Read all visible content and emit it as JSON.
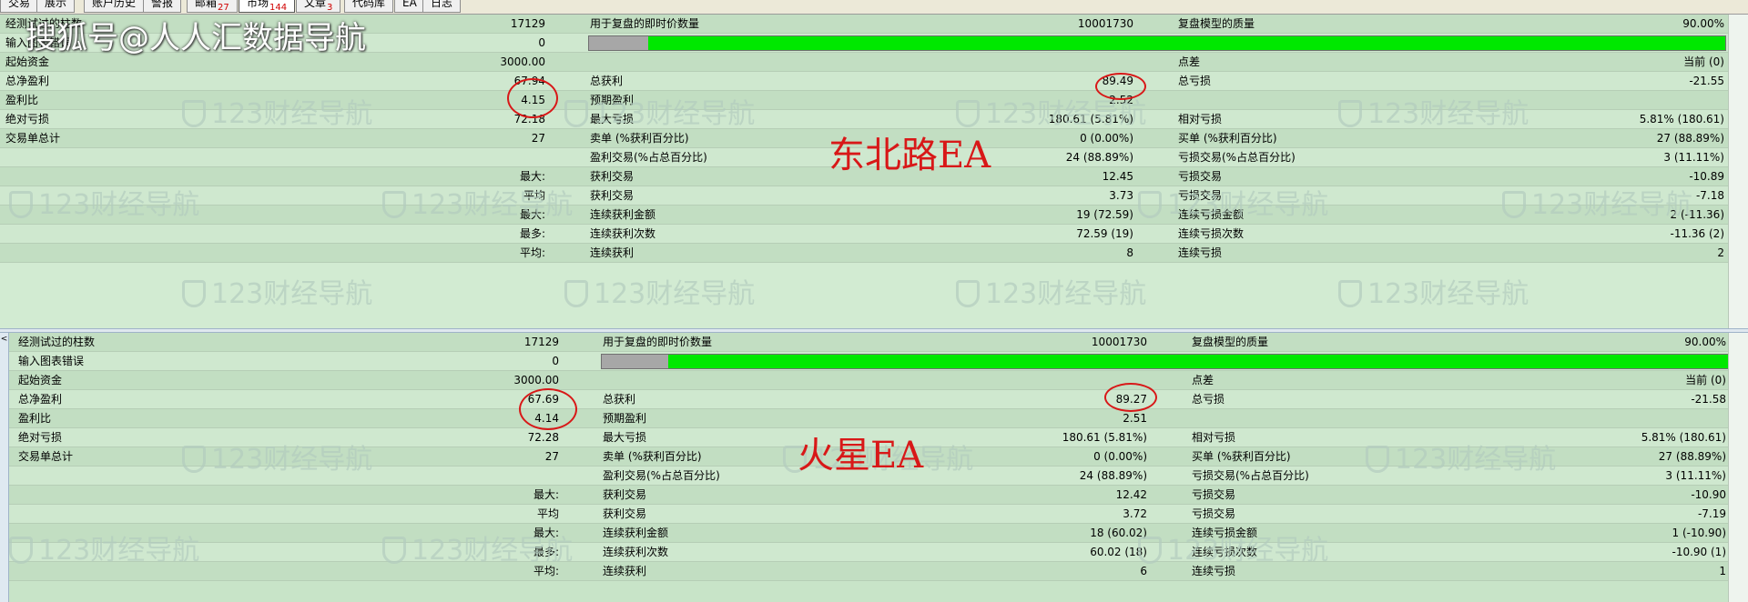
{
  "tabs": [
    {
      "label": "交易",
      "badge": ""
    },
    {
      "label": "展示",
      "badge": ""
    },
    {
      "label": "账户历史",
      "badge": ""
    },
    {
      "label": "警报",
      "badge": ""
    },
    {
      "label": "邮箱",
      "badge": "27"
    },
    {
      "label": "市场",
      "badge": "144"
    },
    {
      "label": "文章",
      "badge": "3"
    },
    {
      "label": "代码库",
      "badge": ""
    },
    {
      "label": "EA",
      "badge": ""
    },
    {
      "label": "日志",
      "badge": ""
    }
  ],
  "active_tab": 5,
  "source_watermark": "搜狐号@人人汇数据导航",
  "bg_watermark": "123财经导航",
  "colors": {
    "annotation_red": "#d81818",
    "progress_green": "#00e800",
    "progress_gray": "#a7a7a7"
  },
  "top_report": {
    "annotation_label": "东北路EA",
    "progress_fraction": 0.052,
    "rows": [
      {
        "c1l": "经测试过的柱数",
        "c1v": "17129",
        "c2l": "用于复盘的即时价数量",
        "c2v": "10001730",
        "c3l": "复盘模型的质量",
        "c3v": "90.00%"
      },
      {
        "c1l": "输入图表错误",
        "c1v": "0",
        "bar": true
      },
      {
        "c1l": "起始资金",
        "c1v": "3000.00",
        "c2l": "",
        "c2v": "",
        "c3l": "点差",
        "c3v": "当前 (0)"
      },
      {
        "c1l": "总净盈利",
        "c1v": "67.94",
        "c2l": "总获利",
        "c2v": "89.49",
        "c3l": "总亏损",
        "c3v": "-21.55"
      },
      {
        "c1l": "盈利比",
        "c1v": "4.15",
        "c2l": "预期盈利",
        "c2v": "2.52",
        "c3l": "",
        "c3v": ""
      },
      {
        "c1l": "绝对亏损",
        "c1v": "72.18",
        "c2l": "最大亏损",
        "c2v": "180.61 (5.81%)",
        "c3l": "相对亏损",
        "c3v": "5.81% (180.61)"
      },
      {
        "c1l": "交易单总计",
        "c1v": "27",
        "c2l": "卖单 (%获利百分比)",
        "c2v": "0 (0.00%)",
        "c3l": "买单 (%获利百分比)",
        "c3v": "27 (88.89%)"
      },
      {
        "c1l": "",
        "c1v": "",
        "c2l": "盈利交易(%占总百分比)",
        "c2v": "24 (88.89%)",
        "c3l": "亏损交易(%占总百分比)",
        "c3v": "3 (11.11%)"
      },
      {
        "c1l": "",
        "c1v": "最大:",
        "c2l": "获利交易",
        "c2v": "12.45",
        "c3l": "亏损交易",
        "c3v": "-10.89"
      },
      {
        "c1l": "",
        "c1v": "平均",
        "c2l": "获利交易",
        "c2v": "3.73",
        "c3l": "亏损交易",
        "c3v": "-7.18"
      },
      {
        "c1l": "",
        "c1v": "最大:",
        "c2l": "连续获利金额",
        "c2v": "19 (72.59)",
        "c3l": "连续亏损金额",
        "c3v": "2 (-11.36)"
      },
      {
        "c1l": "",
        "c1v": "最多:",
        "c2l": "连续获利次数",
        "c2v": "72.59 (19)",
        "c3l": "连续亏损次数",
        "c3v": "-11.36 (2)"
      },
      {
        "c1l": "",
        "c1v": "平均:",
        "c2l": "连续获利",
        "c2v": "8",
        "c3l": "连续亏损",
        "c3v": "2"
      }
    ]
  },
  "bottom_report": {
    "annotation_label": "火星EA",
    "progress_fraction": 0.058,
    "left_arrow": "<",
    "rows": [
      {
        "c1l": "经测试过的柱数",
        "c1v": "17129",
        "c2l": "用于复盘的即时价数量",
        "c2v": "10001730",
        "c3l": "复盘模型的质量",
        "c3v": "90.00%"
      },
      {
        "c1l": "输入图表错误",
        "c1v": "0",
        "bar": true
      },
      {
        "c1l": "起始资金",
        "c1v": "3000.00",
        "c2l": "",
        "c2v": "",
        "c3l": "点差",
        "c3v": "当前 (0)"
      },
      {
        "c1l": "总净盈利",
        "c1v": "67.69",
        "c2l": "总获利",
        "c2v": "89.27",
        "c3l": "总亏损",
        "c3v": "-21.58"
      },
      {
        "c1l": "盈利比",
        "c1v": "4.14",
        "c2l": "预期盈利",
        "c2v": "2.51",
        "c3l": "",
        "c3v": ""
      },
      {
        "c1l": "绝对亏损",
        "c1v": "72.28",
        "c2l": "最大亏损",
        "c2v": "180.61 (5.81%)",
        "c3l": "相对亏损",
        "c3v": "5.81% (180.61)"
      },
      {
        "c1l": "交易单总计",
        "c1v": "27",
        "c2l": "卖单 (%获利百分比)",
        "c2v": "0 (0.00%)",
        "c3l": "买单 (%获利百分比)",
        "c3v": "27 (88.89%)"
      },
      {
        "c1l": "",
        "c1v": "",
        "c2l": "盈利交易(%占总百分比)",
        "c2v": "24 (88.89%)",
        "c3l": "亏损交易(%占总百分比)",
        "c3v": "3 (11.11%)"
      },
      {
        "c1l": "",
        "c1v": "最大:",
        "c2l": "获利交易",
        "c2v": "12.42",
        "c3l": "亏损交易",
        "c3v": "-10.90"
      },
      {
        "c1l": "",
        "c1v": "平均",
        "c2l": "获利交易",
        "c2v": "3.72",
        "c3l": "亏损交易",
        "c3v": "-7.19"
      },
      {
        "c1l": "",
        "c1v": "最大:",
        "c2l": "连续获利金额",
        "c2v": "18 (60.02)",
        "c3l": "连续亏损金额",
        "c3v": "1 (-10.90)"
      },
      {
        "c1l": "",
        "c1v": "最多:",
        "c2l": "连续获利次数",
        "c2v": "60.02 (18)",
        "c3l": "连续亏损次数",
        "c3v": "-10.90 (1)"
      },
      {
        "c1l": "",
        "c1v": "平均:",
        "c2l": "连续获利",
        "c2v": "6",
        "c3l": "连续亏损",
        "c3v": "1"
      }
    ]
  }
}
